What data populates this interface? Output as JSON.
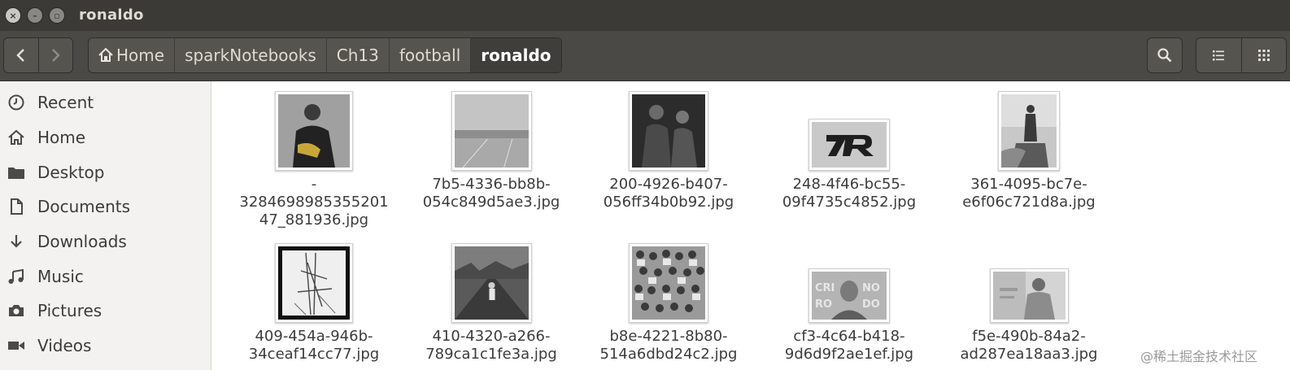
{
  "window": {
    "title": "ronaldo"
  },
  "toolbar": {
    "breadcrumb": [
      "Home",
      "sparkNotebooks",
      "Ch13",
      "football",
      "ronaldo"
    ]
  },
  "sidebar": {
    "items": [
      {
        "label": "Recent",
        "icon": "clock-icon"
      },
      {
        "label": "Home",
        "icon": "home-icon"
      },
      {
        "label": "Desktop",
        "icon": "folder-icon"
      },
      {
        "label": "Documents",
        "icon": "document-icon"
      },
      {
        "label": "Downloads",
        "icon": "download-icon"
      },
      {
        "label": "Music",
        "icon": "music-icon"
      },
      {
        "label": "Pictures",
        "icon": "camera-icon"
      },
      {
        "label": "Videos",
        "icon": "video-icon"
      }
    ]
  },
  "files": [
    {
      "name": "-\n3284698985355201\n47_881936.jpg"
    },
    {
      "name": "7b5-4336-bb8b-\n054c849d5ae3.jpg"
    },
    {
      "name": "200-4926-b407-\n056ff34b0b92.jpg"
    },
    {
      "name": "248-4f46-bc55-\n09f4735c4852.jpg"
    },
    {
      "name": "361-4095-bc7e-\ne6f06c721d8a.jpg"
    },
    {
      "name": "409-454a-946b-\n34ceaf14cc77.jpg"
    },
    {
      "name": "410-4320-a266-\n789ca1c1fe3a.jpg"
    },
    {
      "name": "b8e-4221-8b80-\n514a6dbd24c2.jpg"
    },
    {
      "name": "cf3-4c64-b418-\n9d6d9f2ae1ef.jpg"
    },
    {
      "name": "f5e-490b-84a2-\nad287ea18aa3.jpg"
    }
  ],
  "watermark": "@稀土掘金技术社区"
}
